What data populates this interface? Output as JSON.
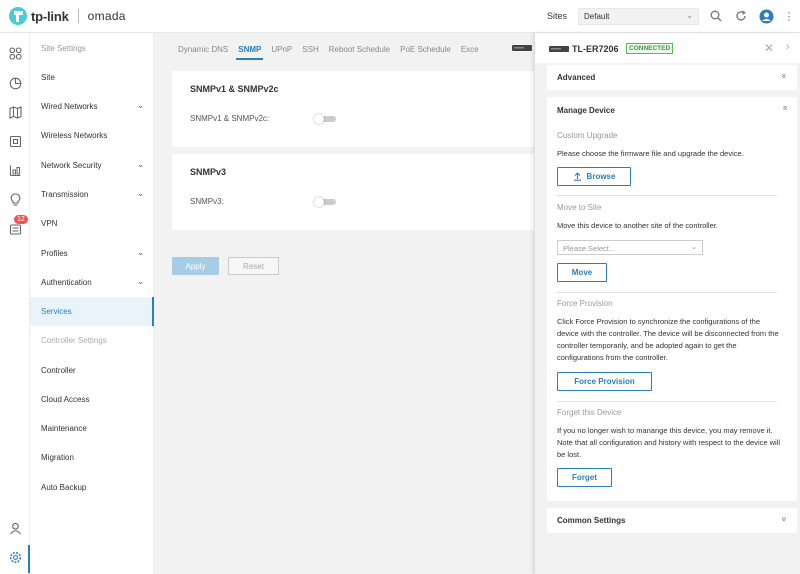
{
  "header": {
    "brand": "tp-link",
    "product": "omada",
    "sites_label": "Sites",
    "site_selected": "Default"
  },
  "rail": {
    "notification_count": "12"
  },
  "sidebar": {
    "title": "Site Settings",
    "items": [
      {
        "label": "Site"
      },
      {
        "label": "Wired Networks"
      },
      {
        "label": "Wireless Networks"
      },
      {
        "label": "Network Security"
      },
      {
        "label": "Transmission"
      },
      {
        "label": "VPN"
      },
      {
        "label": "Profiles"
      },
      {
        "label": "Authentication"
      },
      {
        "label": "Services"
      },
      {
        "label": "Controller Settings"
      },
      {
        "label": "Controller"
      },
      {
        "label": "Cloud Access"
      },
      {
        "label": "Maintenance"
      },
      {
        "label": "Migration"
      },
      {
        "label": "Auto Backup"
      }
    ]
  },
  "tabs": [
    "Dynamic DNS",
    "SNMP",
    "UPnP",
    "SSH",
    "Reboot Schedule",
    "PoE Schedule",
    "Exce"
  ],
  "snmp_v1v2": {
    "title": "SNMPv1 & SNMPv2c",
    "label": "SNMPv1 & SNMPv2c:",
    "enabled": false
  },
  "snmp_v3": {
    "title": "SNMPv3",
    "label": "SNMPv3:",
    "enabled": false
  },
  "actions": {
    "apply": "Apply",
    "reset": "Reset"
  },
  "device_panel": {
    "device_name": "TL-ER7206",
    "status": "CONNECTED",
    "advanced": "Advanced",
    "manage_device": "Manage Device",
    "custom_upgrade": "Custom Upgrade",
    "custom_upgrade_text": "Please choose the firmware file and upgrade the device.",
    "browse": "Browse",
    "move_to_site": "Move to Site",
    "move_text": "Move this device to another site of the controller.",
    "select_placeholder": "Please Select...",
    "move": "Move",
    "force_provision": "Force Provision",
    "force_text": "Click Force Provision to synchronize the configurations of the device with the controller. The device will be disconnected from the controller temporarily, and be adopted again to get the configurations from the controller.",
    "force_button": "Force Provision",
    "forget_device": "Forget this Device",
    "forget_text": "If you no longer wish to manange this device, you may remove it. Note that all configuration and history with respect to the device will be lost.",
    "forget": "Forget",
    "common_settings": "Common Settings"
  },
  "colors": {
    "accent": "#2b7fb6",
    "connected": "#5cb85c",
    "badge": "#e85555"
  }
}
